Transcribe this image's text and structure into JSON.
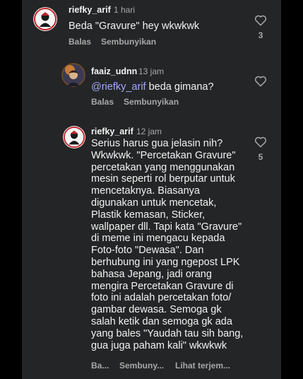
{
  "comments": [
    {
      "username": "riefky_arif",
      "time": "1 hari",
      "text": "Beda \"Gravure\" hey wkwkwk",
      "actions": [
        "Balas",
        "Sembunyikan"
      ],
      "likes": "3"
    },
    {
      "username": "faaiz_udnn",
      "time": "13 jam",
      "mention": "@riefky_arif",
      "text": " beda gimana?",
      "actions": [
        "Balas",
        "Sembunyikan"
      ]
    },
    {
      "username": "riefky_arif",
      "time": "12 jam",
      "text": "Serius harus gua jelasin nih?\nWkwkwk. \"Percetakan Gravure\"\npercetakan yang menggunakan\nmesin seperti rol berputar untuk\nmencetaknya. Biasanya\ndigunakan untuk mencetak,\nPlastik kemasan, Sticker,\nwallpaper dll. Tapi kata \"Gravure\"\ndi meme ini mengacu kepada\nFoto-foto \"Dewasa\". Dan\nberhubung ini yang ngepost LPK\nbahasa Jepang, jadi orang\nmengira Percetakan Gravure di\nfoto ini adalah percetakan foto/\ngambar dewasa. Semoga gk\nsalah ketik dan semoga gk ada\nyang bales \"Yaudah tau sih bang,\ngua juga paham kali\" wkwkwk",
      "actions": [
        "Ba...",
        "Sembuny...",
        "Lihat terjem..."
      ],
      "likes": "5"
    }
  ],
  "icons": {
    "like": "heart-outline-icon"
  },
  "colors": {
    "background": "#242526",
    "text": "#f2f2f2",
    "secondary": "#a8a8a8",
    "mention": "#a3a9ff"
  }
}
